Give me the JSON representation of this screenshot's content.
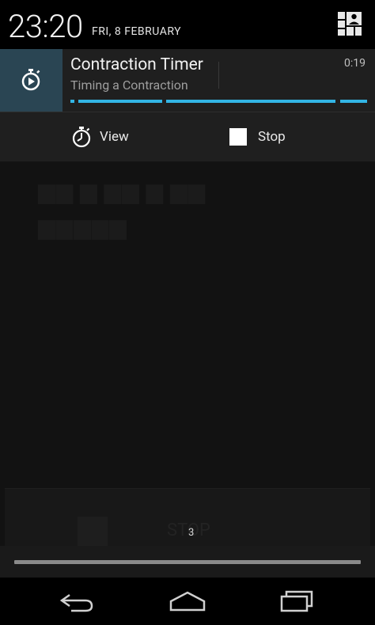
{
  "status": {
    "time": "23:20",
    "date": "FRI, 8 FEBRUARY"
  },
  "notification": {
    "title": "Contraction Timer",
    "subtitle": "Timing a Contraction",
    "elapsed": "0:19",
    "accent_color": "#33b5e5",
    "icon": "stopwatch-play-icon",
    "actions": [
      {
        "label": "View",
        "icon": "stopwatch-icon"
      },
      {
        "label": "Stop",
        "icon": "stop-square-icon"
      }
    ]
  },
  "background_app": {
    "button_badge": "3"
  },
  "navbar": {
    "buttons": [
      "back-icon",
      "home-icon",
      "recent-apps-icon"
    ]
  }
}
